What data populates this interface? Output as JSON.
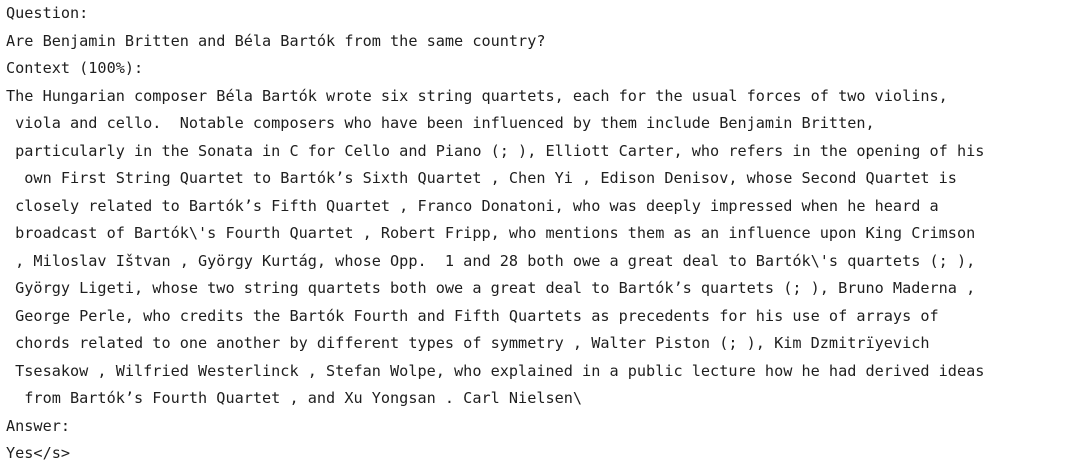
{
  "question_label": "Question:",
  "question_text": "Are Benjamin Britten and Béla Bartók from the same country?",
  "context_label": "Context (100%):",
  "context_lines": [
    "The Hungarian composer Béla Bartók wrote six string quartets, each for the usual forces of two violins,",
    " viola and cello.  Notable composers who have been influenced by them include Benjamin Britten,",
    " particularly in the Sonata in C for Cello and Piano (; ), Elliott Carter, who refers in the opening of his",
    "  own First String Quartet to Bartók’s Sixth Quartet , Chen Yi , Edison Denisov, whose Second Quartet is",
    " closely related to Bartók’s Fifth Quartet , Franco Donatoni, who was deeply impressed when he heard a",
    " broadcast of Bartók\\'s Fourth Quartet , Robert Fripp, who mentions them as an influence upon King Crimson",
    " , Miloslav Ištvan , György Kurtág, whose Opp.  1 and 28 both owe a great deal to Bartók\\'s quartets (; ),",
    " György Ligeti, whose two string quartets both owe a great deal to Bartók’s quartets (; ), Bruno Maderna ,",
    " George Perle, who credits the Bartók Fourth and Fifth Quartets as precedents for his use of arrays of",
    " chords related to one another by different types of symmetry , Walter Piston (; ), Kim Dzmitrïyevich",
    " Tsesakow , Wilfried Westerlinck , Stefan Wolpe, who explained in a public lecture how he had derived ideas",
    "  from Bartók’s Fourth Quartet , and Xu Yongsan . Carl Nielsen\\"
  ],
  "answer_label": "Answer:",
  "answer_text": "Yes</s>"
}
